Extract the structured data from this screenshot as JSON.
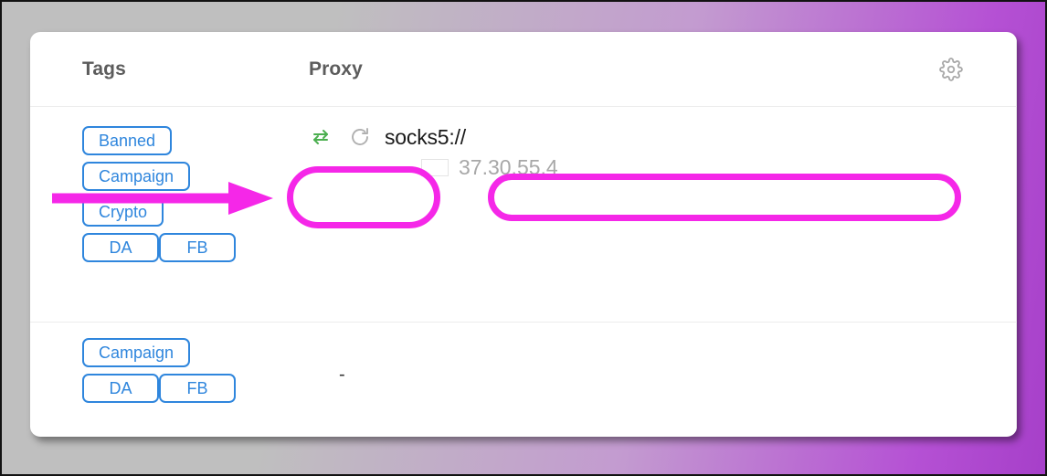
{
  "window": {
    "background_gradient_from": "#bfbfbf",
    "background_gradient_to": "#a63fc9"
  },
  "header": {
    "columns": [
      {
        "key": "tags",
        "label": "Tags"
      },
      {
        "key": "proxy",
        "label": "Proxy"
      }
    ],
    "settings_icon": "gear-icon"
  },
  "rows": [
    {
      "tags": [
        [
          "Banned"
        ],
        [
          "Campaign"
        ],
        [
          "Crypto"
        ],
        [
          "DA",
          "FB"
        ]
      ],
      "proxy": {
        "swap_icon": "swap-arrows-icon",
        "refresh_icon": "refresh-icon",
        "scheme": "socks5://",
        "host_value": "",
        "host_placeholder": "",
        "country_flag": "poland-flag-icon",
        "ip": "37.30.55.4"
      }
    },
    {
      "tags": [
        [
          "Campaign"
        ],
        [
          "DA",
          "FB"
        ]
      ],
      "proxy": {
        "empty_value": "-"
      }
    }
  ],
  "annotations": {
    "color": "#f527e8",
    "arrow": "arrow-pointing-right",
    "highlight_controls": "proxy-controls-highlight",
    "highlight_input": "proxy-host-input-highlight"
  },
  "colors": {
    "tag_blue": "#2f86dd",
    "header_text": "#5c5c5c",
    "ip_gray": "#a8a8a8",
    "flag_red": "#d0253f",
    "swap_green": "#4caf50",
    "annotation_magenta": "#f527e8"
  }
}
